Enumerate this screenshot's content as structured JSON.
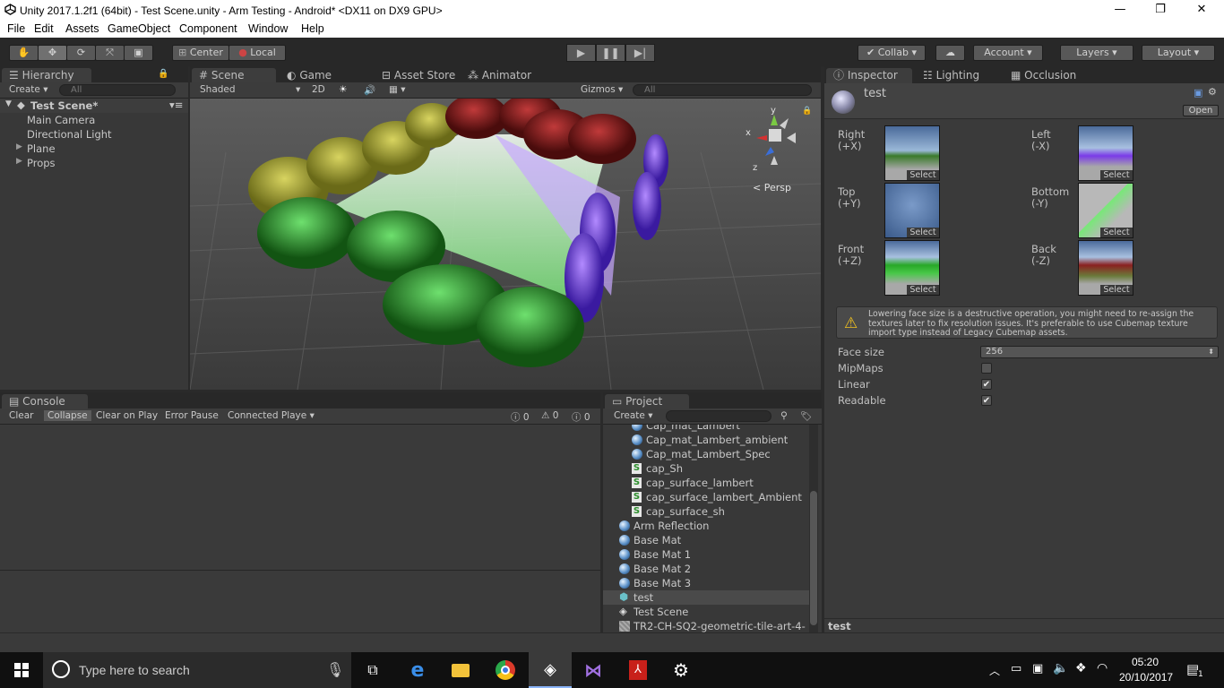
{
  "window": {
    "title": "Unity 2017.1.2f1 (64bit) - Test Scene.unity - Arm Testing - Android* <DX11 on DX9 GPU>"
  },
  "menu": [
    "File",
    "Edit",
    "Assets",
    "GameObject",
    "Component",
    "Window",
    "Help"
  ],
  "toolbar": {
    "pivot_center": "Center",
    "pivot_local": "Local",
    "collab": "Collab",
    "account": "Account",
    "layers": "Layers",
    "layout": "Layout"
  },
  "hierarchy": {
    "tab": "Hierarchy",
    "create": "Create",
    "search_placeholder": "All",
    "scene": "Test Scene*",
    "items": [
      "Main Camera",
      "Directional Light",
      "Plane",
      "Props"
    ]
  },
  "scene_tabs": {
    "scene": "Scene",
    "game": "Game",
    "asset_store": "Asset Store",
    "animator": "Animator"
  },
  "scene_bar": {
    "shading": "Shaded",
    "mode_2d": "2D",
    "gizmos": "Gizmos",
    "search_placeholder": "All",
    "persp": "Persp"
  },
  "console": {
    "tab": "Console",
    "clear": "Clear",
    "collapse": "Collapse",
    "clear_on_play": "Clear on Play",
    "error_pause": "Error Pause",
    "connected": "Connected Playe",
    "count_errors": "0",
    "count_warnings": "0",
    "count_logs": "0"
  },
  "project": {
    "tab": "Project",
    "create": "Create",
    "items": [
      {
        "label": "Cap_mat_Lambert",
        "icon": "material",
        "indent": 1
      },
      {
        "label": "Cap_mat_Lambert_ambient",
        "icon": "material",
        "indent": 1
      },
      {
        "label": "Cap_mat_Lambert_Spec",
        "icon": "material",
        "indent": 1
      },
      {
        "label": "cap_Sh",
        "icon": "shader",
        "indent": 1
      },
      {
        "label": "cap_surface_lambert",
        "icon": "shader",
        "indent": 1
      },
      {
        "label": "cap_surface_lambert_Ambient",
        "icon": "shader",
        "indent": 1
      },
      {
        "label": "cap_surface_sh",
        "icon": "shader",
        "indent": 1
      },
      {
        "label": "Arm Reflection",
        "icon": "material",
        "indent": 0
      },
      {
        "label": "Base Mat",
        "icon": "material",
        "indent": 0
      },
      {
        "label": "Base Mat 1",
        "icon": "material",
        "indent": 0
      },
      {
        "label": "Base Mat 2",
        "icon": "material",
        "indent": 0
      },
      {
        "label": "Base Mat 3",
        "icon": "material",
        "indent": 0
      },
      {
        "label": "test",
        "icon": "cubemap",
        "indent": 0
      },
      {
        "label": "Test Scene",
        "icon": "scene",
        "indent": 0
      },
      {
        "label": "TR2-CH-SQ2-geometric-tile-art-4-",
        "icon": "texture",
        "indent": 0
      }
    ]
  },
  "inspector": {
    "tabs": [
      "Inspector",
      "Lighting",
      "Occlusion"
    ],
    "asset_name": "test",
    "open": "Open",
    "faces": [
      {
        "name": "Right",
        "axis": "(+X)",
        "select": "Select"
      },
      {
        "name": "Left",
        "axis": "(-X)",
        "select": "Select"
      },
      {
        "name": "Top",
        "axis": "(+Y)",
        "select": "Select"
      },
      {
        "name": "Bottom",
        "axis": "(-Y)",
        "select": "Select"
      },
      {
        "name": "Front",
        "axis": "(+Z)",
        "select": "Select"
      },
      {
        "name": "Back",
        "axis": "(-Z)",
        "select": "Select"
      }
    ],
    "warning": "Lowering face size is a destructive operation, you might need to re-assign the textures later to fix resolution issues. It's preferable to use Cubemap texture import type instead of Legacy Cubemap assets.",
    "face_size_label": "Face size",
    "face_size_value": "256",
    "mipmaps_label": "MipMaps",
    "mipmaps": false,
    "linear_label": "Linear",
    "linear": true,
    "readable_label": "Readable",
    "readable": true,
    "footer": "test"
  },
  "taskbar": {
    "search_placeholder": "Type here to search",
    "time": "05:20",
    "date": "20/10/2017",
    "notifications": "1"
  },
  "colors": {
    "accent_blue": "#3e7fd8",
    "panel": "#383838",
    "selection": "#4a4a4a"
  }
}
